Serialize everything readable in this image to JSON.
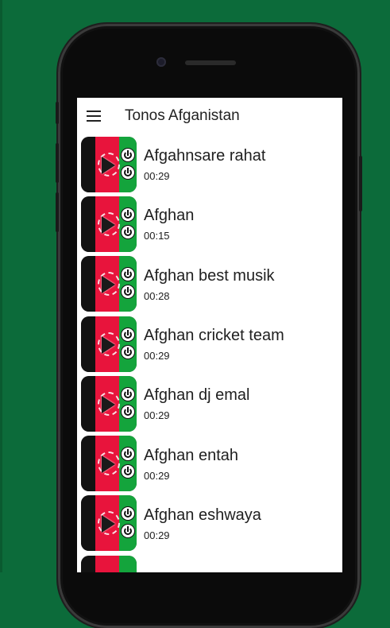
{
  "app": {
    "title": "Tonos Afganistan"
  },
  "items": [
    {
      "title": "Afgahnsare rahat",
      "duration": "00:29"
    },
    {
      "title": "Afghan",
      "duration": "00:15"
    },
    {
      "title": "Afghan best musik",
      "duration": "00:28"
    },
    {
      "title": "Afghan cricket team",
      "duration": "00:29"
    },
    {
      "title": "Afghan dj emal",
      "duration": "00:29"
    },
    {
      "title": "Afghan entah",
      "duration": "00:29"
    },
    {
      "title": "Afghan eshwaya",
      "duration": "00:29"
    }
  ],
  "colors": {
    "background": "#0c6b3a",
    "flag_black": "#121212",
    "flag_red": "#e8143c",
    "flag_green": "#14a43c"
  },
  "icons": {
    "menu": "hamburger-icon",
    "play": "play-icon",
    "ringtone": "power-icon"
  }
}
